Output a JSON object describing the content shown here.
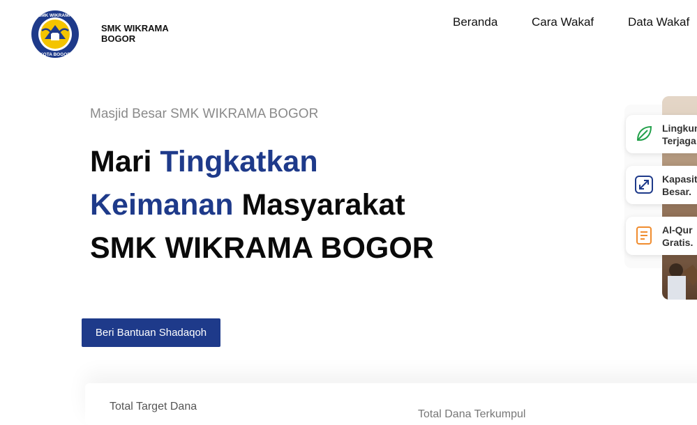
{
  "header": {
    "logo_text_top": "SMK WIKRAMA",
    "logo_text_bottom": "KOTA BOGOR",
    "brand_line1": "SMK WIKRAMA",
    "brand_line2": "BOGOR"
  },
  "nav": {
    "items": [
      "Beranda",
      "Cara Wakaf",
      "Data Wakaf"
    ]
  },
  "hero": {
    "subtitle": "Masjid Besar SMK WIKRAMA BOGOR",
    "headline": {
      "part1": "Mari ",
      "part2": "Tingkatkan",
      "part3": "Keimanan",
      "part4": " Masyarakat",
      "part5": "SMK WIKRAMA BOGOR"
    },
    "cta_label": "Beri Bantuan Shadaqoh"
  },
  "features": [
    {
      "line1": "Lingkun",
      "line2": "Terjaga",
      "icon": "leaf-icon",
      "color": "#22a04a"
    },
    {
      "line1": "Kapasit",
      "line2": "Besar.",
      "icon": "expand-icon",
      "color": "#1e3a8a"
    },
    {
      "line1": "Al-Qur",
      "line2": "Gratis.",
      "icon": "book-icon",
      "color": "#f08c2e"
    }
  ],
  "stats": {
    "label1": "Total Target Dana",
    "label2": "Total Dana Terkumpul"
  },
  "colors": {
    "primary": "#1e3a8a",
    "accent_green": "#22a04a",
    "accent_orange": "#f08c2e"
  }
}
